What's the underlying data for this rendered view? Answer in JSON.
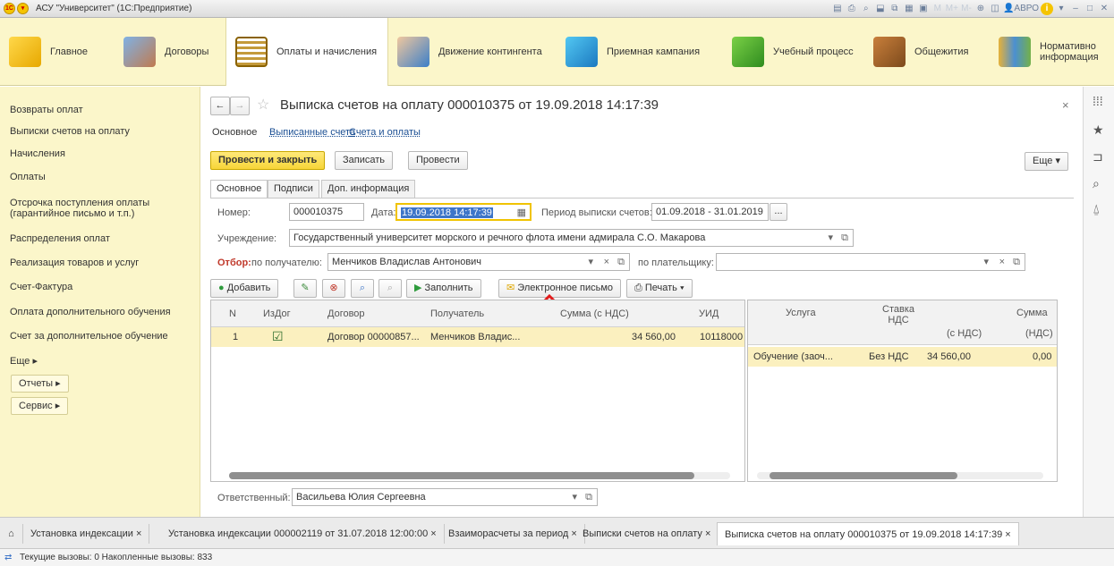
{
  "window": {
    "title": "АСУ \"Университет\" (1С:Предприятие)",
    "toolbar_icons": [
      "print-icon",
      "print-preview-icon",
      "zoom-icon",
      "save-icon",
      "copy-icon",
      "calc-icon",
      "calendar-icon",
      "memory-icon",
      "history-icon",
      "find-icon",
      "layout-icon",
      "info-icon",
      "settings-icon",
      "minimize-icon",
      "restore-icon",
      "close-icon"
    ],
    "memory_labels": [
      "M",
      "M+",
      "M-"
    ],
    "user": "АВРО",
    "brand_color": "#f5c400"
  },
  "sections": [
    {
      "label": "Главное"
    },
    {
      "label": "Договоры"
    },
    {
      "label": "Оплаты и начисления"
    },
    {
      "label": "Движение контингента"
    },
    {
      "label": "Приемная кампания"
    },
    {
      "label": "Учебный процесс"
    },
    {
      "label": "Общежития"
    },
    {
      "label": "Нормативно\nинформация"
    }
  ],
  "nav": {
    "items": [
      "Возвраты оплат",
      "Выписки счетов на оплату",
      "Начисления",
      "Оплаты",
      "Отсрочка поступления оплаты\n(гарантийное письмо и т.п.)",
      "Распределения оплат",
      "Реализация товаров и услуг",
      "Счет-Фактура",
      "Оплата дополнительного обучения",
      "Счет за дополнительное обучение",
      "Еще ▸"
    ],
    "reports": "Отчеты ▸",
    "service": "Сервис ▸"
  },
  "form": {
    "title": "Выписка счетов на оплату 000010375 от 19.09.2018 14:17:39",
    "close": "×",
    "links": [
      "Основное",
      "Выписанные счета",
      "Счета и оплаты"
    ],
    "buttons": {
      "post_close": "Провести и закрыть",
      "save": "Записать",
      "post": "Провести",
      "more": "Еще ▾"
    },
    "tabs": [
      "Основное",
      "Подписи",
      "Доп. информация"
    ],
    "number_label": "Номер:",
    "number": "000010375",
    "date_label": "Дата:",
    "date": "19.09.2018 14:17:39",
    "period_label": "Период выписки счетов:",
    "period": "01.09.2018 - 31.01.2019",
    "period_btn": "...",
    "org_label": "Учреждение:",
    "org": "Государственный университет морского и речного флота имени адмирала С.О. Макарова",
    "filter_label": "Отбор:",
    "filter_recipient_label": "по получателю:",
    "filter_recipient": "Менчиков Владислав Антонович",
    "filter_payer_label": "по плательщику:",
    "filter_payer": "",
    "grid_buttons": {
      "add": "Добавить",
      "fill": "Заполнить",
      "email": "Электронное письмо",
      "print": "Печать ▾"
    },
    "responsible_label": "Ответственный:",
    "responsible": "Васильева Юлия Сергеевна"
  },
  "left_grid": {
    "columns": [
      "N",
      "ИзДог",
      "Договор",
      "Получатель",
      "Сумма (с НДС)",
      "УИД"
    ],
    "rows": [
      {
        "n": "1",
        "izdog": "☑",
        "contract": "Договор 00000857...",
        "recipient": "Менчиков Владис...",
        "sum": "34 560,00",
        "uid": "10118000"
      }
    ]
  },
  "right_grid": {
    "columns": [
      "Услуга",
      "Ставка\nНДС",
      "Сумма",
      "(с НДС)",
      "(НДС)"
    ],
    "rows": [
      {
        "service": "Обучение (заоч...",
        "rate": "Без НДС",
        "sum": "34 560,00",
        "vat": "0,00"
      }
    ]
  },
  "bottom_tabs": [
    "Установка индексации ×",
    "Установка индексации 000002119 от 31.07.2018 12:00:00 ×",
    "Взаиморасчеты за период ×",
    "Выписки счетов на оплату ×",
    "Выписка счетов на оплату 000010375 от 19.09.2018 14:17:39 ×"
  ],
  "status": "Текущие вызовы: 0   Накопленные вызовы: 833"
}
